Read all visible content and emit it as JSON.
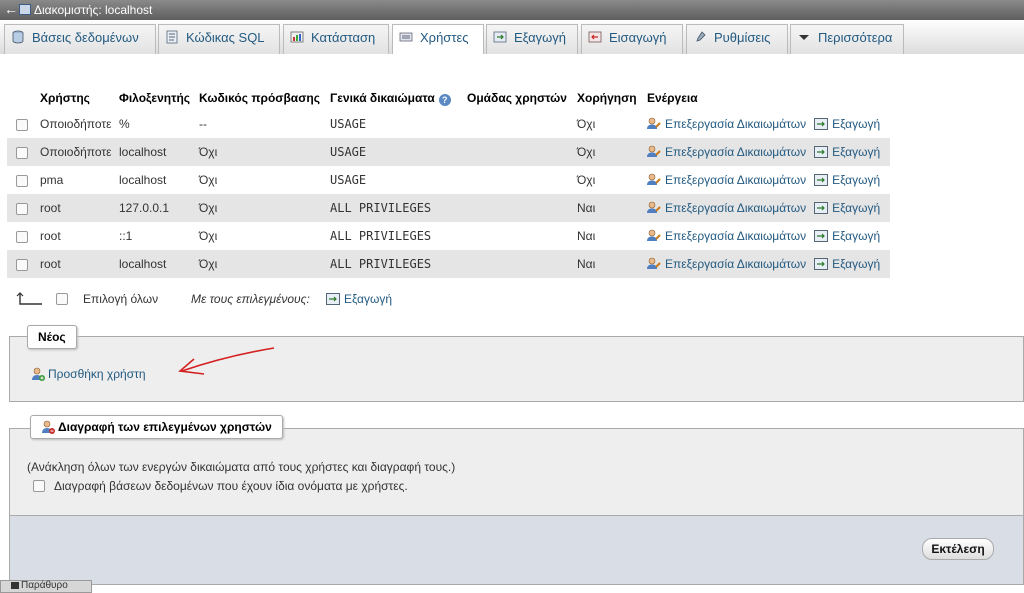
{
  "window": {
    "title": "Διακομιστής: localhost"
  },
  "tabs": [
    {
      "label": "Βάσεις δεδομένων",
      "icon": "databases-icon"
    },
    {
      "label": "Κώδικας SQL",
      "icon": "sql-icon"
    },
    {
      "label": "Κατάσταση",
      "icon": "status-icon"
    },
    {
      "label": "Χρήστες",
      "icon": "users-icon"
    },
    {
      "label": "Εξαγωγή",
      "icon": "export-icon"
    },
    {
      "label": "Εισαγωγή",
      "icon": "import-icon"
    },
    {
      "label": "Ρυθμίσεις",
      "icon": "settings-icon"
    },
    {
      "label": "Περισσότερα",
      "icon": "chevron-down-icon"
    }
  ],
  "table": {
    "headers": [
      "Χρήστης",
      "Φιλοξενητής",
      "Κωδικός πρόσβασης",
      "Γενικά δικαιώματα",
      "Ομάδας χρηστών",
      "Χορήγηση",
      "Ενέργεια"
    ],
    "rows": [
      {
        "user": "Οποιοδήποτε",
        "host": "%",
        "password": "--",
        "privileges": "USAGE",
        "group": "",
        "grant": "Όχι"
      },
      {
        "user": "Οποιοδήποτε",
        "host": "localhost",
        "password": "Όχι",
        "privileges": "USAGE",
        "group": "",
        "grant": "Όχι"
      },
      {
        "user": "pma",
        "host": "localhost",
        "password": "Όχι",
        "privileges": "USAGE",
        "group": "",
        "grant": "Όχι"
      },
      {
        "user": "root",
        "host": "127.0.0.1",
        "password": "Όχι",
        "privileges": "ALL PRIVILEGES",
        "group": "",
        "grant": "Ναι"
      },
      {
        "user": "root",
        "host": "::1",
        "password": "Όχι",
        "privileges": "ALL PRIVILEGES",
        "group": "",
        "grant": "Ναι"
      },
      {
        "user": "root",
        "host": "localhost",
        "password": "Όχι",
        "privileges": "ALL PRIVILEGES",
        "group": "",
        "grant": "Ναι"
      }
    ],
    "edit_label": "Επεξεργασία Δικαιωμάτων",
    "export_label": "Εξαγωγή"
  },
  "bulk": {
    "select_all": "Επιλογή όλων",
    "with_selected": "Με τους επιλεγμένους:",
    "export": "Εξαγωγή"
  },
  "new_section": {
    "legend": "Νέος",
    "add_user": "Προσθήκη χρήστη"
  },
  "delete_section": {
    "legend": "Διαγραφή των επιλεγμένων χρηστών",
    "note": "(Ανάκληση όλων των ενεργών δικαιώματα από τους χρήστες και διαγραφή τους.)",
    "drop_db_label": "Διαγραφή βάσεων δεδομένων που έχουν ίδια ονόματα με χρήστες.",
    "go_button": "Εκτέλεση"
  },
  "statusbar": {
    "label": "Παράθυρο"
  },
  "colors": {
    "link": "#235a81",
    "red": "#d7261c",
    "row_alt": "#e5e5e5"
  }
}
